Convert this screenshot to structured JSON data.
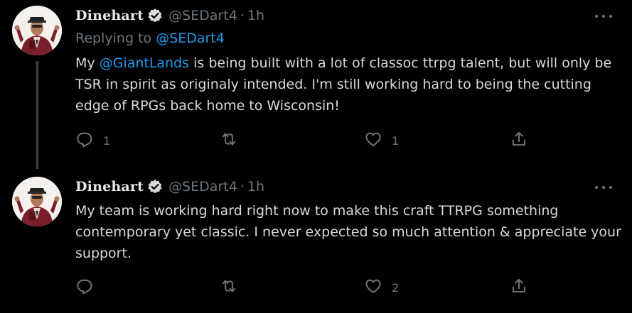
{
  "tweets": [
    {
      "name": "Dinehart",
      "handle": "@SEDart4",
      "dot": "·",
      "time": "1h",
      "replying_prefix": "Replying to ",
      "replying_handle": "@SEDart4",
      "body": {
        "before": "My ",
        "mention": "@GiantLands",
        "after": " is being built with a lot of classoc ttrpg talent, but will only be TSR in spirit as originaly intended. I'm still working hard to being the cutting edge of RPGs back home to Wisconsin!"
      },
      "reply_count": "1",
      "retweet_count": "",
      "like_count": "1"
    },
    {
      "name": "Dinehart",
      "handle": "@SEDart4",
      "dot": "·",
      "time": "1h",
      "body": {
        "text": "My team is working hard right now to make this craft TTRPG something contemporary yet classic. I never expected so much attention & appreciate your support."
      },
      "reply_count": "",
      "retweet_count": "",
      "like_count": "2"
    }
  ],
  "icons": {
    "verified": "verified-badge-icon",
    "more": "more-options-icon",
    "reply": "reply-bubble-icon",
    "retweet": "retweet-icon",
    "like": "heart-icon",
    "share": "share-icon"
  },
  "colors": {
    "background": "#000000",
    "text": "#d9d9d9",
    "muted": "#6e767d",
    "link": "#1d9bf0",
    "thread_line": "#3d4246"
  }
}
